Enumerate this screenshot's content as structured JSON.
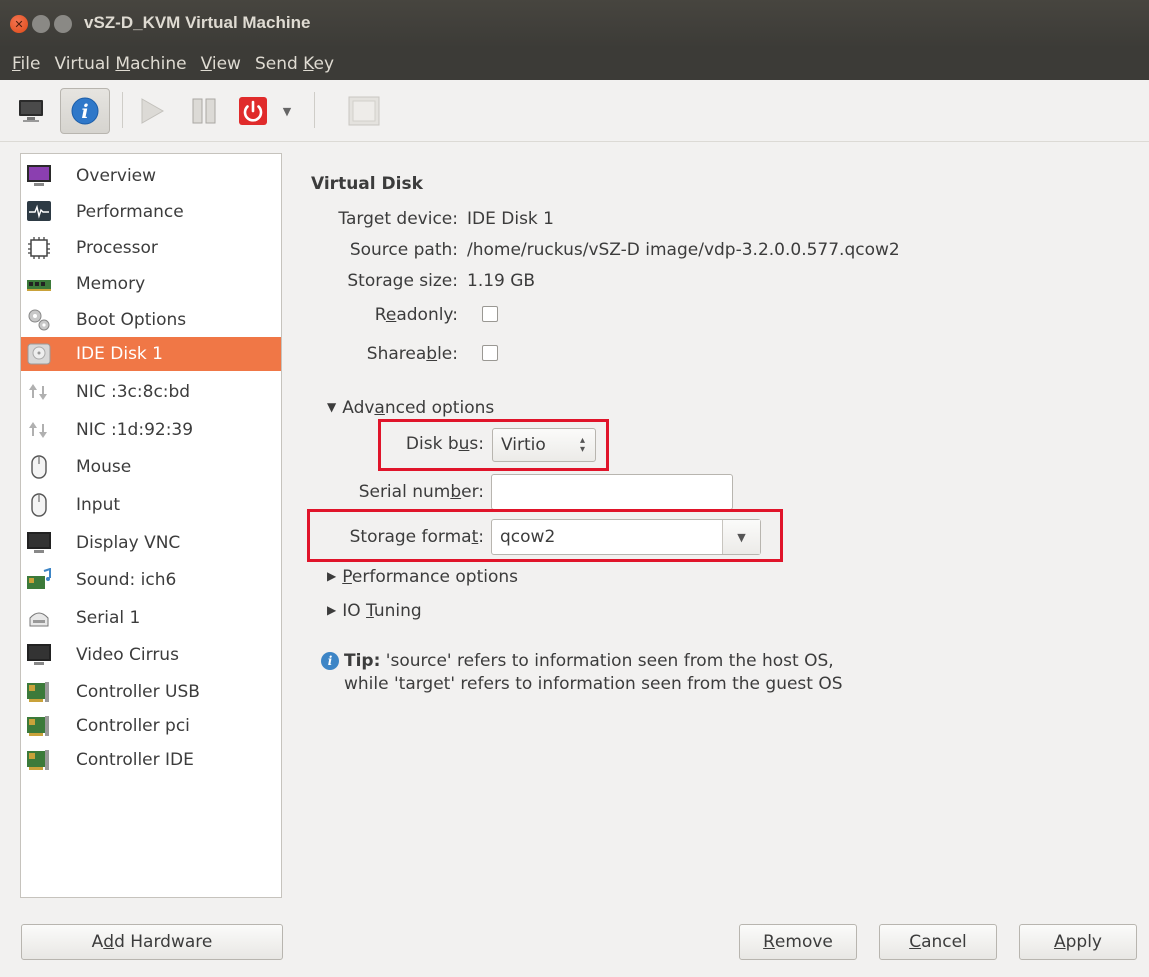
{
  "window": {
    "title": "vSZ-D_KVM Virtual Machine"
  },
  "menubar": [
    {
      "pre": "",
      "u": "F",
      "post": "ile"
    },
    {
      "pre": "Virtual ",
      "u": "M",
      "post": "achine"
    },
    {
      "pre": "",
      "u": "V",
      "post": "iew"
    },
    {
      "pre": "Send ",
      "u": "K",
      "post": "ey"
    }
  ],
  "sidebar": {
    "items": [
      {
        "label": "Overview",
        "icon": "monitor-icon"
      },
      {
        "label": "Performance",
        "icon": "performance-icon"
      },
      {
        "label": "Processor",
        "icon": "chip-icon"
      },
      {
        "label": "Memory",
        "icon": "memory-icon"
      },
      {
        "label": "Boot Options",
        "icon": "gears-icon"
      },
      {
        "label": "IDE Disk 1",
        "icon": "disk-icon"
      },
      {
        "label": "NIC :3c:8c:bd",
        "icon": "network-icon"
      },
      {
        "label": "NIC :1d:92:39",
        "icon": "network-icon"
      },
      {
        "label": "Mouse",
        "icon": "mouse-icon"
      },
      {
        "label": "Input",
        "icon": "mouse-icon"
      },
      {
        "label": "Display VNC",
        "icon": "display-icon"
      },
      {
        "label": "Sound: ich6",
        "icon": "sound-card-icon"
      },
      {
        "label": "Serial 1",
        "icon": "serial-icon"
      },
      {
        "label": "Video Cirrus",
        "icon": "display-icon"
      },
      {
        "label": "Controller USB",
        "icon": "card-icon"
      },
      {
        "label": "Controller pci",
        "icon": "card-icon"
      },
      {
        "label": "Controller IDE",
        "icon": "card-icon"
      }
    ],
    "selected_index": 5
  },
  "details": {
    "section_title": "Virtual Disk",
    "target_device_label": "Target device:",
    "target_device": "IDE Disk 1",
    "source_path_label": "Source path:",
    "source_path": "/home/ruckus/vSZ-D image/vdp-3.2.0.0.577.qcow2",
    "storage_size_label": "Storage size:",
    "storage_size": "1.19 GB",
    "readonly": {
      "pre": "R",
      "u": "e",
      "post": "adonly:",
      "checked": false
    },
    "shareable": {
      "pre": "Sharea",
      "u": "b",
      "post": "le:",
      "checked": false
    },
    "advanced": {
      "pre": "Adv",
      "u": "a",
      "post": "nced options",
      "expanded": true
    },
    "disk_bus": {
      "pre": "Disk b",
      "u": "u",
      "post": "s:",
      "value": "Virtio"
    },
    "serial_number": {
      "pre": "Serial num",
      "u": "b",
      "post": "er:",
      "value": ""
    },
    "storage_format": {
      "pre": "Storage forma",
      "u": "t",
      "post": ":",
      "value": "qcow2"
    },
    "performance_options": {
      "pre": "",
      "u": "P",
      "post": "erformance options"
    },
    "io_tuning": {
      "pre": "IO ",
      "u": "T",
      "post": "uning"
    },
    "tip": {
      "bold": "Tip:",
      "line1": " 'source' refers to information seen from the host OS,",
      "line2": "while 'target' refers to information seen from the guest OS"
    }
  },
  "buttons": {
    "add_hardware": {
      "pre": "A",
      "u": "d",
      "post": "d Hardware"
    },
    "remove": {
      "pre": "",
      "u": "R",
      "post": "emove"
    },
    "cancel": {
      "pre": "",
      "u": "C",
      "post": "ancel"
    },
    "apply": {
      "pre": "",
      "u": "A",
      "post": "pply"
    }
  },
  "colors": {
    "selection": "#f07746",
    "highlight_box": "#e0142a",
    "titlebar": "#3c3b37"
  }
}
